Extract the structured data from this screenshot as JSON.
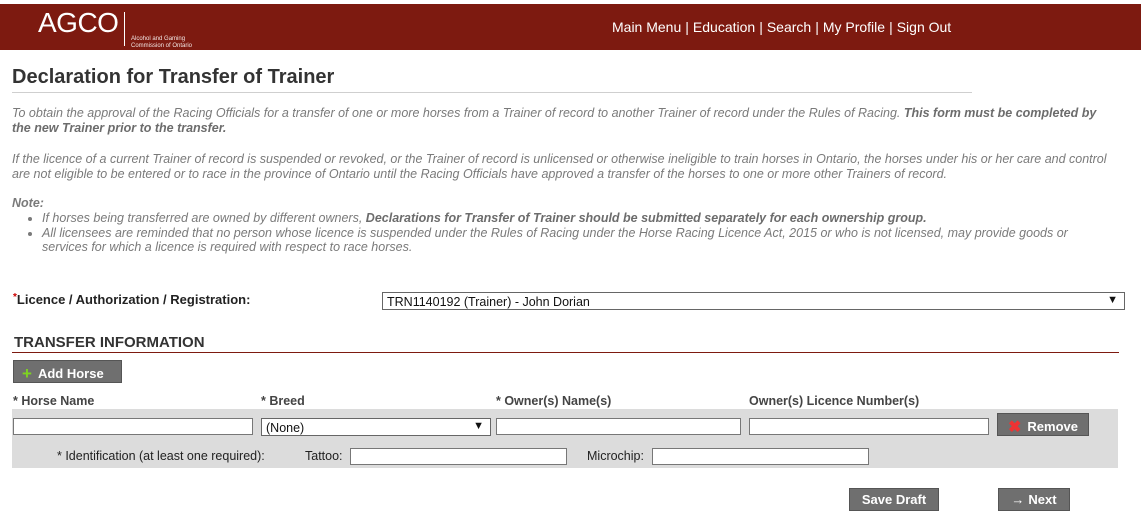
{
  "header": {
    "logo": {
      "text": "AGCO",
      "sub1": "Alcohol and Gaming",
      "sub2": "Commission of Ontario"
    },
    "nav": [
      "Main Menu",
      "Education",
      "Search",
      "My Profile",
      "Sign Out"
    ],
    "nav_separator": "|",
    "bg_color": "#7d1a10"
  },
  "page": {
    "title": "Declaration for Transfer of Trainer",
    "intro1": "To obtain the approval of the Racing Officials for a transfer of one or more horses from a Trainer of record to another Trainer of record under the Rules of Racing. ",
    "intro1_bold": "This form must be completed by the new Trainer prior to the transfer.",
    "intro2": "If the licence of a current Trainer of record is suspended or revoked, or the Trainer of record is unlicensed or otherwise ineligible to train horses in Ontario, the horses under his or her care and control are not eligible to be entered or to race in the province of Ontario until the Racing Officials have approved a transfer of the horses to one or more other Trainers of record.",
    "note_label": "Note:",
    "note1_a": "If horses being transferred are owned by different owners, ",
    "note1_bold": "Declarations for Transfer of Trainer should be submitted separately for each ownership group.",
    "note2": "All licensees are reminded that no person whose licence is suspended under the Rules of Racing under the Horse Racing Licence Act, 2015 or who is not licensed, may provide goods or services for which a licence is required with respect to race horses."
  },
  "form": {
    "required_mark": "*",
    "licence_label": "Licence / Authorization / Registration:",
    "licence_value": "TRN1140192 (Trainer) - John Dorian",
    "dropdown_arrow": "▼",
    "section_title": "TRANSFER INFORMATION",
    "add_horse_plus": "+",
    "add_horse": "Add Horse",
    "columns": {
      "horse_name": "* Horse Name",
      "breed": "* Breed",
      "owners": "* Owner(s) Name(s)",
      "owner_licence": "Owner(s) Licence Number(s)"
    },
    "breed_value": "(None)",
    "horse_name_value": "",
    "owners_value": "",
    "owner_licence_value": "",
    "remove_icon": "✖",
    "remove": "Remove",
    "identification_label": "* Identification (at least one required):",
    "tattoo_label": "Tattoo:",
    "tattoo_value": "",
    "microchip_label": "Microchip:",
    "microchip_value": "",
    "save_draft": "Save Draft",
    "next_icon": "→",
    "next": "Next"
  }
}
